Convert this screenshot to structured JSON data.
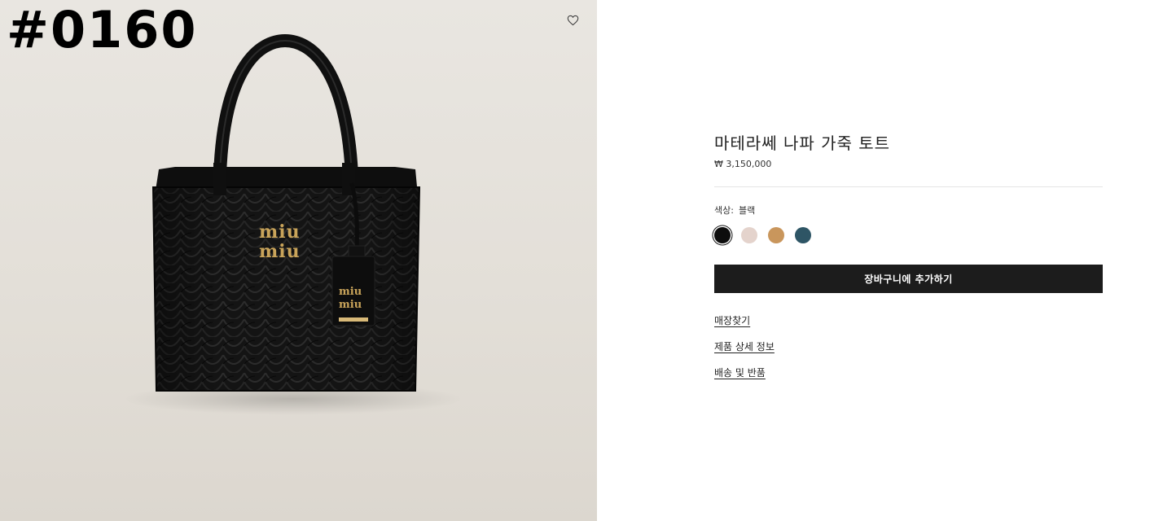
{
  "gallery": {
    "watermark": "#0160",
    "logo_text_line1": "miu",
    "logo_text_line2": "miu",
    "tag_text_line1": "miu",
    "tag_text_line2": "miu"
  },
  "product": {
    "title": "마테라쎄 나파 가죽 토트",
    "price": "₩ 3,150,000",
    "color_label": "색상:",
    "color_value": "블랙",
    "swatches": [
      {
        "name": "black",
        "color": "#0d0d0d",
        "selected": true
      },
      {
        "name": "beige",
        "color": "#e4d3cc",
        "selected": false
      },
      {
        "name": "caramel",
        "color": "#c9965c",
        "selected": false
      },
      {
        "name": "teal-blue",
        "color": "#2e5565",
        "selected": false
      }
    ],
    "add_to_cart": "장바구니에 추가하기",
    "links": {
      "store_finder": "매장찾기",
      "product_details": "제품 상세 정보",
      "shipping_returns": "배송 및 반품"
    }
  },
  "icons": {
    "wishlist": "heart-outline-icon"
  }
}
